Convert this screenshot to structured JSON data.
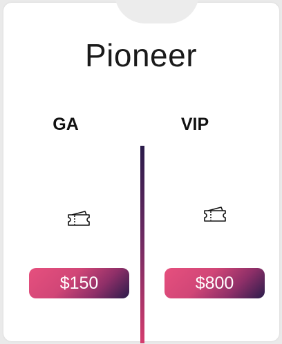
{
  "title": "Pioneer",
  "tiers": [
    {
      "label": "GA",
      "price": "$150",
      "icon": "ticket-icon"
    },
    {
      "label": "VIP",
      "price": "$800",
      "icon": "ticket-icon"
    }
  ],
  "colors": {
    "gradient_start": "#e6507e",
    "gradient_end": "#2b1c4b",
    "divider_top": "#2a1b4a",
    "divider_bottom": "#d53d6e"
  }
}
